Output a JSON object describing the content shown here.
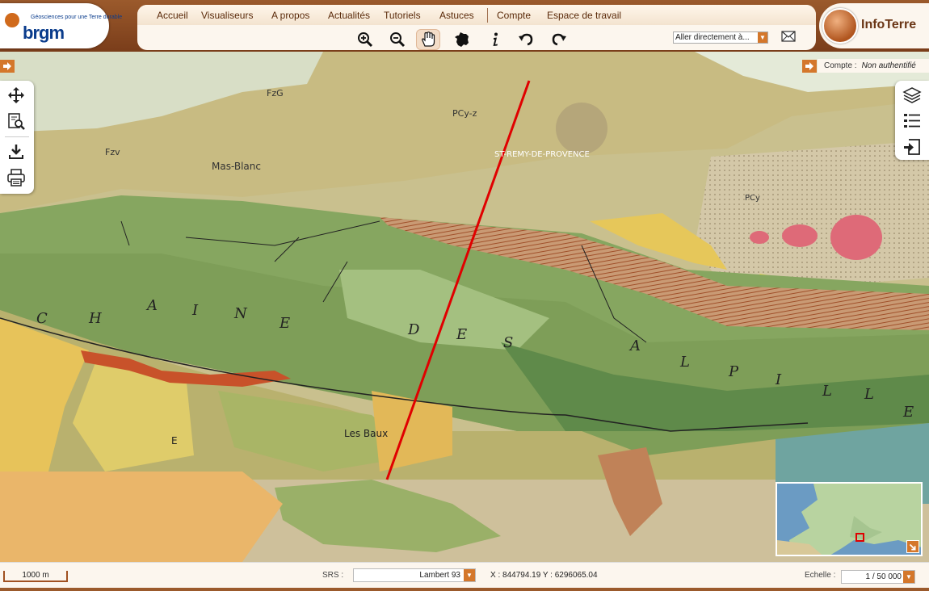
{
  "logo": {
    "tagline": "Géosciences pour une Terre durable",
    "name": "brgm"
  },
  "nav": {
    "items": [
      "Accueil",
      "Visualiseurs",
      "A propos",
      "Actualités",
      "Tutoriels",
      "Astuces",
      "Compte",
      "Espace de travail"
    ]
  },
  "tools": [
    "zoom-in-icon",
    "zoom-out-icon",
    "pan-hand-icon",
    "france-extent-icon",
    "info-icon",
    "undo-icon",
    "redo-icon"
  ],
  "goto": {
    "value": "Aller directement à..."
  },
  "brand": {
    "name": "InfoTerre"
  },
  "account": {
    "label": "Compte :",
    "value": "Non authentifié"
  },
  "map": {
    "labels": [
      "FzG",
      "PCy-z",
      "Fzv",
      "Mas-Blanc",
      "ST-REMY-DE-PROVENCE",
      "C",
      "H",
      "A",
      "I",
      "N",
      "E",
      "D",
      "E",
      "S",
      "A",
      "L",
      "P",
      "I",
      "L",
      "L",
      "E",
      "Les Baux",
      "E",
      "PCy"
    ]
  },
  "footer": {
    "scale": "1000 m",
    "srs_label": "SRS :",
    "srs_value": "Lambert 93",
    "coords": "X : 844794.19 Y : 6296065.04",
    "echelle_label": "Echelle :",
    "echelle_value": "1 / 50 000"
  },
  "colors": {
    "header_brown": "#8a4a22",
    "accent_orange": "#d4772b",
    "cross_section_red": "#e00000"
  }
}
